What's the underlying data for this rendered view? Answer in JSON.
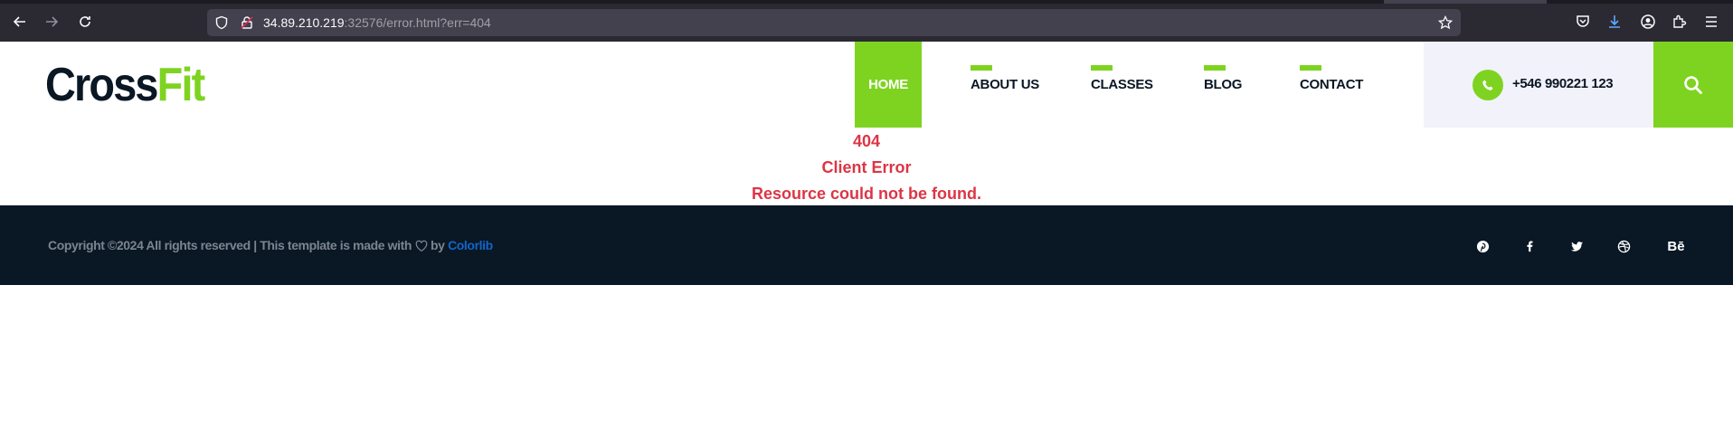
{
  "browser": {
    "url_host": "34.89.210.219",
    "url_path": ":32576/error.html?err=404"
  },
  "site": {
    "logo_part1": "Cross",
    "logo_part2": "Fit",
    "nav": [
      {
        "label": "HOME",
        "active": true
      },
      {
        "label": "ABOUT US",
        "active": false
      },
      {
        "label": "CLASSES",
        "active": false
      },
      {
        "label": "BLOG",
        "active": false
      },
      {
        "label": "CONTACT",
        "active": false
      }
    ],
    "phone": "+546 990221 123"
  },
  "error": {
    "code": "404",
    "title": "Client Error",
    "message": "Resource could not be found."
  },
  "footer": {
    "copyright_prefix": "Copyright ©2024 All rights reserved | This template is made with",
    "copyright_by": "by",
    "copyright_link": "Colorlib",
    "social_icons": [
      "pinterest-icon",
      "facebook-icon",
      "twitter-icon",
      "dribbble-icon",
      "behance-icon"
    ],
    "behance_text": "Bē"
  },
  "colors": {
    "accent": "#7ed321",
    "dark": "#0a1724",
    "error": "#dc3545",
    "link": "#1266c8"
  }
}
